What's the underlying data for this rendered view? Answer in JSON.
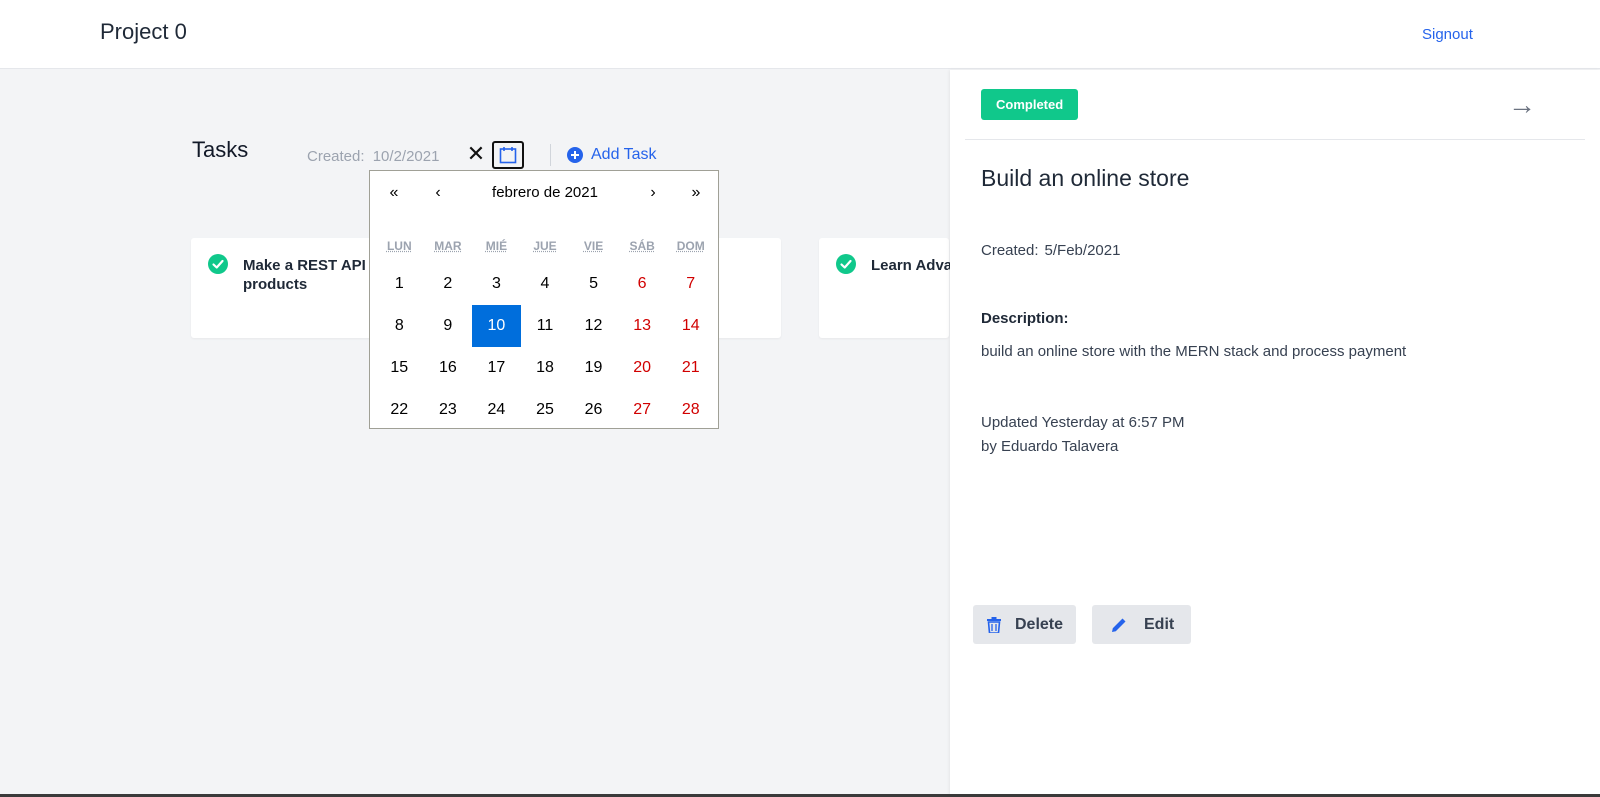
{
  "app": {
    "title": "Project 0",
    "signout_label": "Signout"
  },
  "tasks_header": {
    "title": "Tasks",
    "created_label": "Created:",
    "created_value": "10/2/2021",
    "add_task_label": "Add Task"
  },
  "datepicker": {
    "month_label": "febrero de 2021",
    "nav": {
      "prev_year": "«",
      "prev_month": "‹",
      "next_month": "›",
      "next_year": "»"
    },
    "weekdays": [
      "LUN",
      "MAR",
      "MIÉ",
      "JUE",
      "VIE",
      "SÁB",
      "DOM"
    ],
    "days": [
      "1",
      "2",
      "3",
      "4",
      "5",
      "6",
      "7",
      "8",
      "9",
      "10",
      "11",
      "12",
      "13",
      "14",
      "15",
      "16",
      "17",
      "18",
      "19",
      "20",
      "21",
      "22",
      "23",
      "24",
      "25",
      "26",
      "27",
      "28"
    ],
    "selected_day": "10"
  },
  "cards": [
    {
      "title": "Make a REST API products"
    },
    {
      "title": "Learn Adva"
    }
  ],
  "panel": {
    "status": "Completed",
    "title": "Build an online store",
    "created_label": "Created:",
    "created_value": "5/Feb/2021",
    "description_label": "Description:",
    "description": "build an online store with the MERN stack and process payment",
    "updated": "Updated Yesterday at 6:57 PM",
    "updated_by": "by Eduardo Talavera",
    "delete_label": "Delete",
    "edit_label": "Edit"
  },
  "colors": {
    "accent": "#2563eb",
    "completed": "#10c88b",
    "selected_day": "#006edc",
    "weekend": "#d10000"
  }
}
